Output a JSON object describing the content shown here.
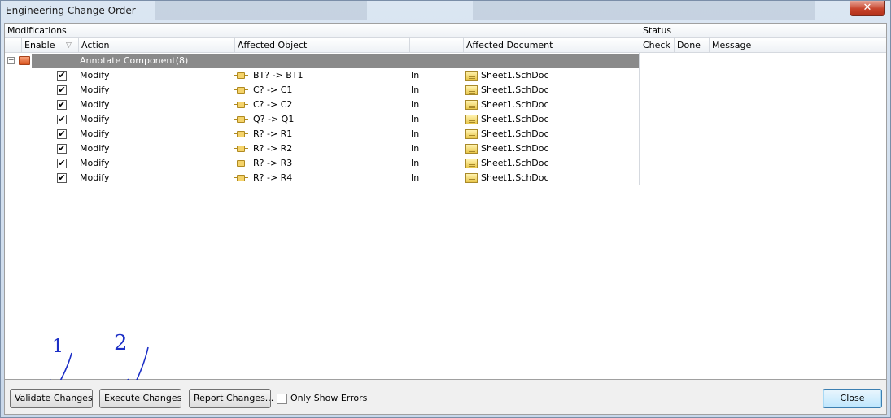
{
  "window": {
    "title": "Engineering Change Order",
    "close_glyph": "✕"
  },
  "headers": {
    "group_modifications": "Modifications",
    "group_status": "Status",
    "enable": "Enable",
    "sort_glyph": "▽",
    "action": "Action",
    "affected_object": "Affected Object",
    "affected_document": "Affected Document",
    "check": "Check",
    "done": "Done",
    "message": "Message"
  },
  "group": {
    "expander": "−",
    "label": "Annotate Component(8)"
  },
  "rows": [
    {
      "enabled": "✔",
      "action": "Modify",
      "object": "BT? -> BT1",
      "direction": "In",
      "document": "Sheet1.SchDoc"
    },
    {
      "enabled": "✔",
      "action": "Modify",
      "object": "C? -> C1",
      "direction": "In",
      "document": "Sheet1.SchDoc"
    },
    {
      "enabled": "✔",
      "action": "Modify",
      "object": "C? -> C2",
      "direction": "In",
      "document": "Sheet1.SchDoc"
    },
    {
      "enabled": "✔",
      "action": "Modify",
      "object": "Q? -> Q1",
      "direction": "In",
      "document": "Sheet1.SchDoc"
    },
    {
      "enabled": "✔",
      "action": "Modify",
      "object": "R? -> R1",
      "direction": "In",
      "document": "Sheet1.SchDoc"
    },
    {
      "enabled": "✔",
      "action": "Modify",
      "object": "R? -> R2",
      "direction": "In",
      "document": "Sheet1.SchDoc"
    },
    {
      "enabled": "✔",
      "action": "Modify",
      "object": "R? -> R3",
      "direction": "In",
      "document": "Sheet1.SchDoc"
    },
    {
      "enabled": "✔",
      "action": "Modify",
      "object": "R? -> R4",
      "direction": "In",
      "document": "Sheet1.SchDoc"
    }
  ],
  "buttons": {
    "validate": "Validate Changes",
    "execute": "Execute Changes",
    "report": "Report Changes...",
    "close": "Close"
  },
  "options": {
    "only_show_errors": "Only Show Errors"
  },
  "annotations": {
    "first": "1",
    "second": "2"
  },
  "colors": {
    "annotation_ink": "#1c2fc6",
    "group_row_bg": "#8a8a8a"
  }
}
